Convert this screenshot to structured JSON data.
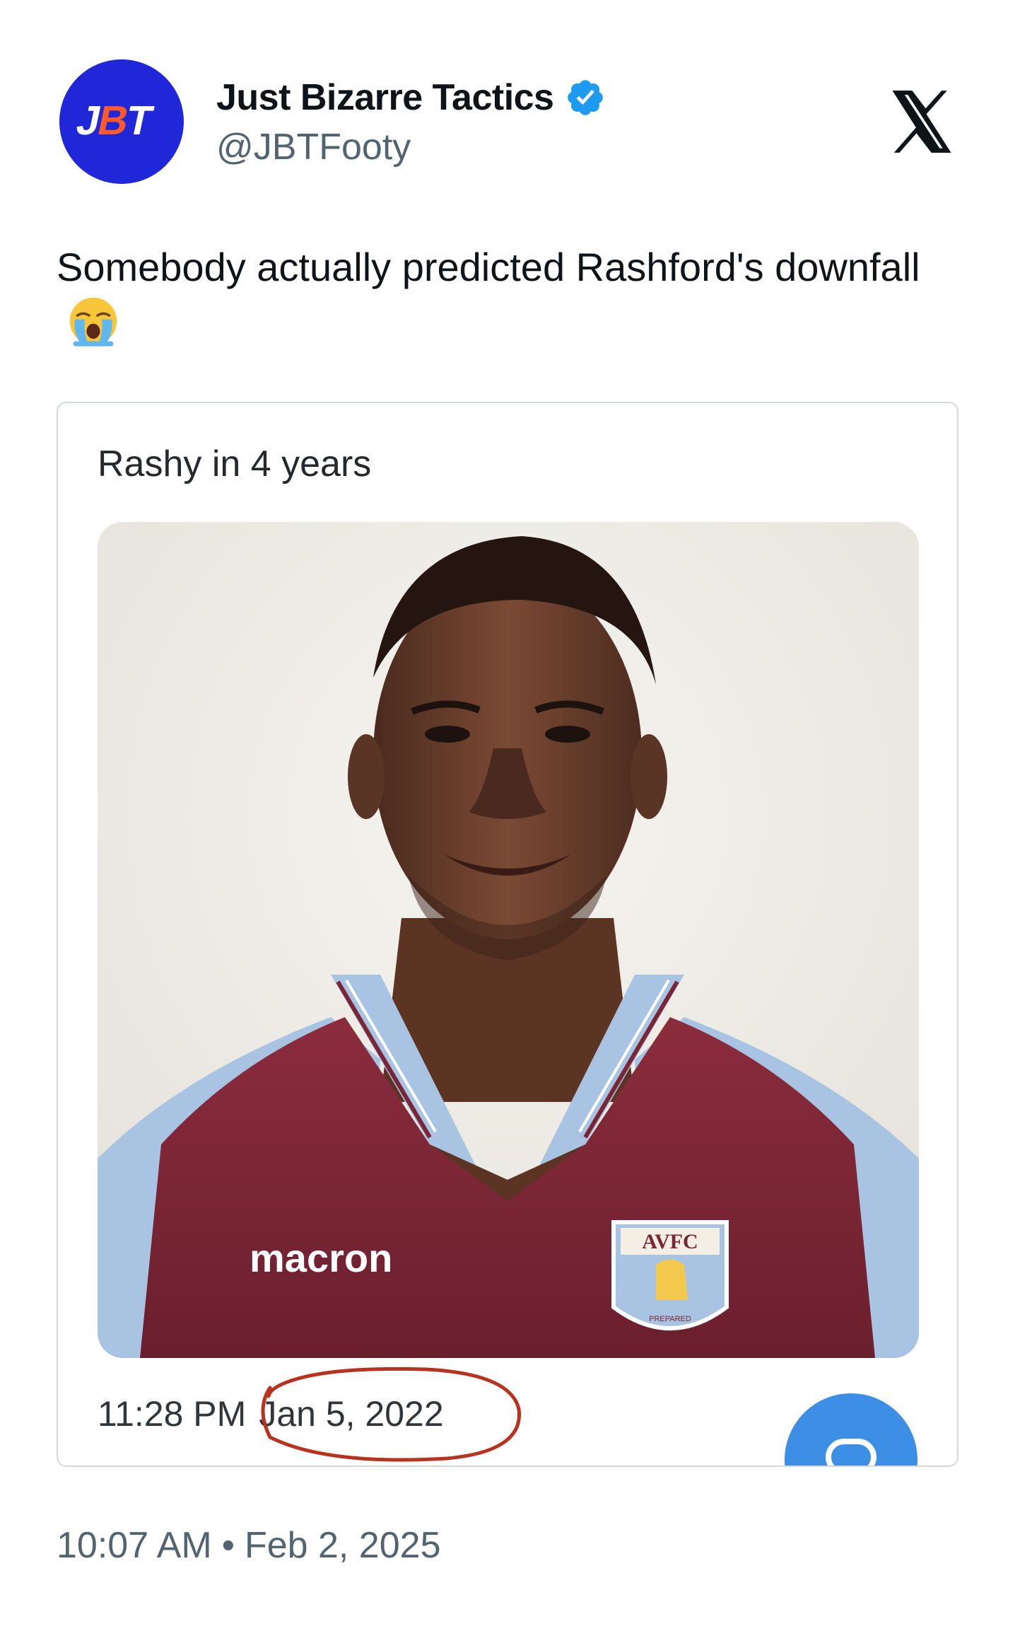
{
  "author": {
    "display_name": "Just Bizarre Tactics",
    "handle": "@JBTFooty",
    "avatar_text": "JBT"
  },
  "tweet": {
    "text": "Somebody actually predicted Rashford's downfall",
    "emoji_icon": "loudly-crying-face-icon"
  },
  "quoted": {
    "text": "Rashy in 4 years",
    "time": "11:28 PM",
    "date": "Jan 5, 2022",
    "media": {
      "shirt_sponsor": "macron",
      "crest_text": "AVFC",
      "crest_motto": "PREPARED"
    }
  },
  "footer": {
    "time": "10:07 AM",
    "separator": "•",
    "date": "Feb 2, 2025"
  },
  "colors": {
    "avatar_bg": "#1f27d8",
    "avatar_accent": "#ff5a2a",
    "verified": "#1d9bf0",
    "annotation_red": "#b8321e",
    "fab_blue": "#3d8fe6",
    "shirt_claret": "#7a2535",
    "shirt_sky": "#a8c4e2"
  },
  "icons": {
    "verified": "verified-badge-icon",
    "platform_logo": "x-logo-icon",
    "fab": "compose-icon"
  }
}
